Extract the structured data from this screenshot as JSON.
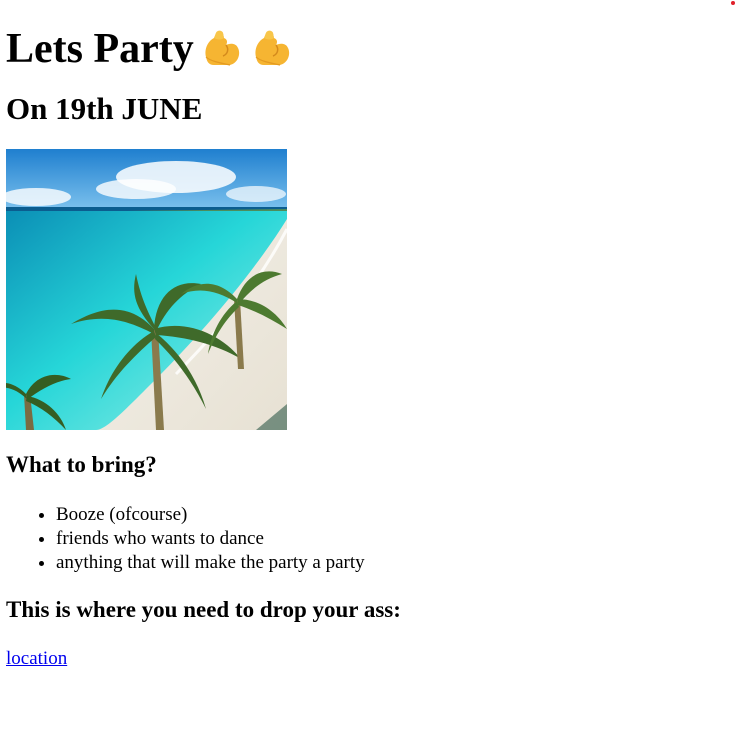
{
  "title": "Lets Party",
  "title_icons": [
    "flexed-biceps-icon",
    "flexed-biceps-icon"
  ],
  "subtitle": "On 19th JUNE",
  "image": {
    "alt": "beach-image"
  },
  "bring": {
    "heading": "What to bring?",
    "items": [
      "Booze (ofcourse)",
      "friends who wants to dance",
      "anything that will make the party a party"
    ]
  },
  "drop": {
    "heading": "This is where you need to drop your ass:"
  },
  "location_link": "location",
  "colors": {
    "link": "#0000ee",
    "indicator_dot": "#e0202a"
  }
}
